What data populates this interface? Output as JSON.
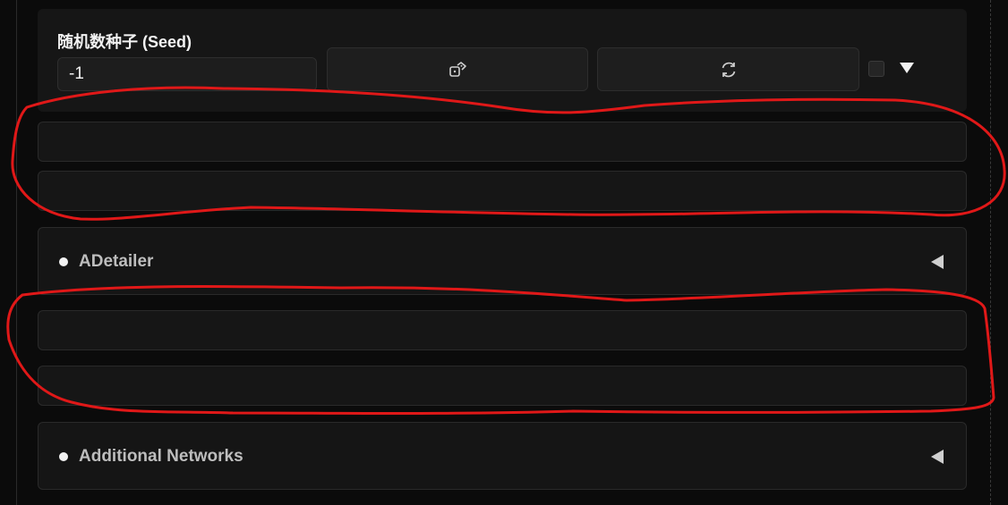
{
  "seed": {
    "label": "随机数种子 (Seed)",
    "value": "-1",
    "dice_icon": "dice-icon",
    "recycle_icon": "recycle-icon",
    "extra_checked": false,
    "toggle_icon": "triangle-down-icon"
  },
  "accordions": [
    {
      "label": "ADetailer",
      "dot_icon": "bullet-icon",
      "caret_icon": "triangle-left-icon"
    },
    {
      "label": "Additional Networks",
      "dot_icon": "bullet-icon",
      "caret_icon": "triangle-left-icon"
    }
  ],
  "annotations": {
    "color": "#e01818",
    "shape": "freehand red outlines around empty bars"
  },
  "colors": {
    "background": "#0b0b0b",
    "panel": "#161616",
    "border": "#2a2a2a",
    "label": "#bdbdbd"
  }
}
